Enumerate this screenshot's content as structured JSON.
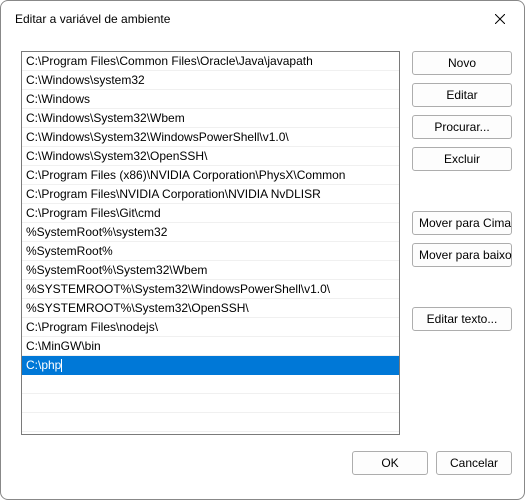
{
  "window": {
    "title": "Editar a variável de ambiente"
  },
  "list": {
    "items": [
      "C:\\Program Files\\Common Files\\Oracle\\Java\\javapath",
      "C:\\Windows\\system32",
      "C:\\Windows",
      "C:\\Windows\\System32\\Wbem",
      "C:\\Windows\\System32\\WindowsPowerShell\\v1.0\\",
      "C:\\Windows\\System32\\OpenSSH\\",
      "C:\\Program Files (x86)\\NVIDIA Corporation\\PhysX\\Common",
      "C:\\Program Files\\NVIDIA Corporation\\NVIDIA NvDLISR",
      "C:\\Program Files\\Git\\cmd",
      "%SystemRoot%\\system32",
      "%SystemRoot%",
      "%SystemRoot%\\System32\\Wbem",
      "%SYSTEMROOT%\\System32\\WindowsPowerShell\\v1.0\\",
      "%SYSTEMROOT%\\System32\\OpenSSH\\",
      "C:\\Program Files\\nodejs\\",
      "C:\\MinGW\\bin"
    ],
    "editing_value": "C:\\php",
    "empty_rows": 3
  },
  "buttons": {
    "new": "Novo",
    "edit": "Editar",
    "browse": "Procurar...",
    "delete": "Excluir",
    "move_up": "Mover para Cima",
    "move_down": "Mover para baixo",
    "edit_text": "Editar texto...",
    "ok": "OK",
    "cancel": "Cancelar"
  }
}
